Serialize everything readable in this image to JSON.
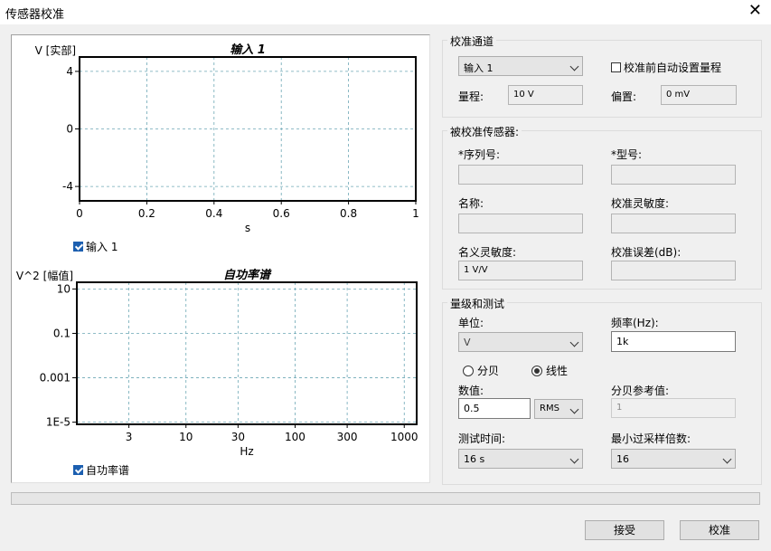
{
  "window": {
    "title": "传感器校准",
    "close": "✕"
  },
  "plots": {
    "time": {
      "title": "输入 1",
      "ylabel": "V [实部]",
      "xlabel": "s",
      "yticks": [
        "4",
        "0",
        "-4"
      ],
      "xticks": [
        "0",
        "0.2",
        "0.4",
        "0.6",
        "0.8",
        "1"
      ],
      "legend": "输入 1",
      "legend_checked": true
    },
    "spectrum": {
      "title": "自功率谱",
      "ylabel": "V^2 [幅值]",
      "xlabel": "Hz",
      "yticks": [
        "10",
        "0.1",
        "0.001",
        "1E-5"
      ],
      "xticks": [
        "3",
        "10",
        "30",
        "100",
        "300",
        "1000"
      ],
      "legend": "自功率谱",
      "legend_checked": true
    }
  },
  "chart_data": [
    {
      "type": "line",
      "title": "输入 1",
      "xlabel": "s",
      "ylabel": "V [实部]",
      "xlim": [
        0,
        1
      ],
      "ylim": [
        -5,
        5
      ],
      "grid": true,
      "series": []
    },
    {
      "type": "line",
      "title": "自功率谱",
      "xlabel": "Hz",
      "ylabel": "V^2 [幅值]",
      "xscale": "log",
      "yscale": "log",
      "xlim": [
        1,
        1300
      ],
      "ylim": [
        8e-06,
        20
      ],
      "grid": true,
      "series": []
    }
  ],
  "calib_channel": {
    "group": "校准通道",
    "channel": "输入 1",
    "auto_range_label": "校准前自动设置量程",
    "auto_range_checked": false,
    "range_label": "量程:",
    "range_value": "10 V",
    "offset_label": "偏置:",
    "offset_value": "0 mV"
  },
  "sensor": {
    "group": "被校准传感器:",
    "serial_label": "*序列号:",
    "model_label": "*型号:",
    "name_label": "名称:",
    "calib_sens_label": "校准灵敏度:",
    "nominal_sens_label": "名义灵敏度:",
    "nominal_sens_value": "1 V/V",
    "calib_err_label": "校准误差(dB):"
  },
  "level": {
    "group": "量级和测试",
    "unit_label": "单位:",
    "unit_value": "V",
    "freq_label": "频率(Hz):",
    "freq_value": "1k",
    "radio_db": "分贝",
    "radio_linear": "线性",
    "value_label": "数值:",
    "value": "0.5",
    "rms": "RMS",
    "dbref_label": "分贝参考值:",
    "dbref_value": "1",
    "time_label": "测试时间:",
    "time_value": "16 s",
    "oversample_label": "最小过采样倍数:",
    "oversample_value": "16"
  },
  "progress": {
    "value": 0
  },
  "buttons": {
    "accept": "接受",
    "calibrate": "校准"
  }
}
